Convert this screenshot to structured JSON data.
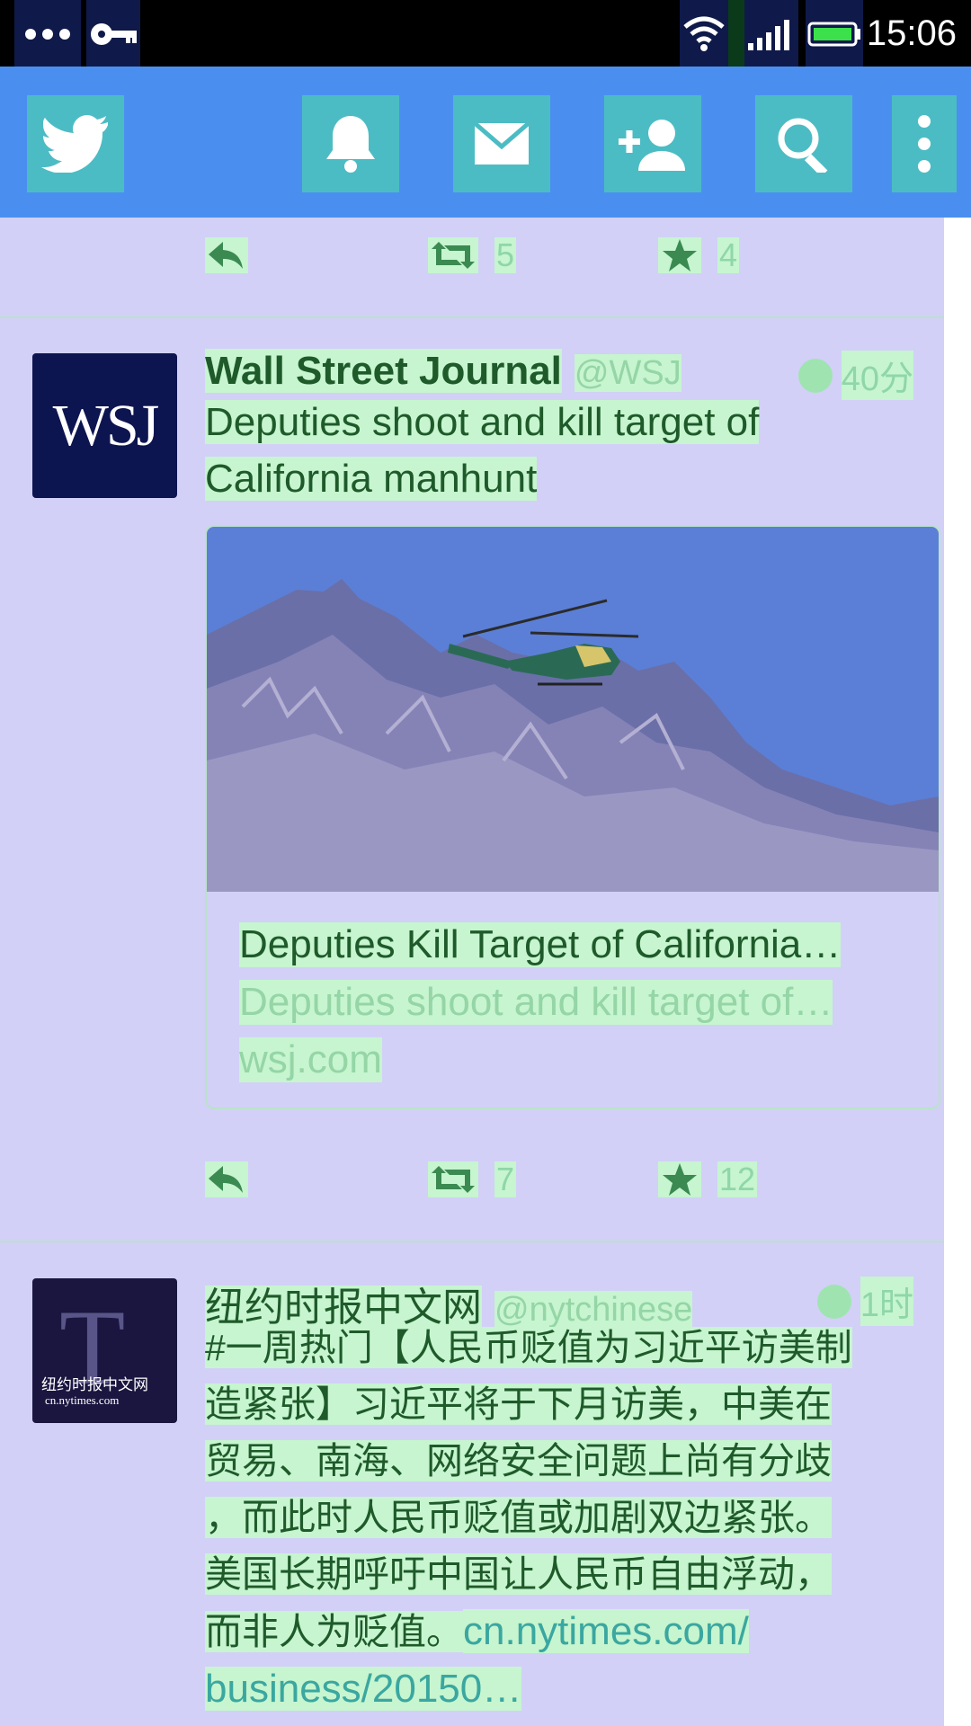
{
  "status_bar": {
    "time": "15:06",
    "icons": [
      "more-dots-icon",
      "key-icon",
      "wifi-icon",
      "signal-icon",
      "battery-icon"
    ]
  },
  "toolbar": {
    "buttons": [
      "twitter-bird-icon",
      "notifications-bell-icon",
      "messages-envelope-icon",
      "add-user-icon",
      "search-icon",
      "more-vert-icon"
    ]
  },
  "tweets": [
    {
      "actions": {
        "retweets": "5",
        "favorites": "4"
      }
    },
    {
      "author": "Wall Street Journal",
      "handle": "@WSJ",
      "time": "40分",
      "avatar_text": "WSJ",
      "text_lines": [
        "Deputies shoot and kill target of",
        "California manhunt"
      ],
      "card": {
        "title": "Deputies Kill Target of California…",
        "description": "Deputies shoot and kill target of…",
        "domain": "wsj.com"
      },
      "actions": {
        "retweets": "7",
        "favorites": "12"
      }
    },
    {
      "author": "纽约时报中文网",
      "handle": "@nytchinese",
      "time": "1时",
      "avatar_text": "纽约时报中文网",
      "avatar_subtext": "cn.nytimes.com",
      "text_lines": [
        "#一周热门【人民币贬值为习近平访美制",
        "造紧张】习近平将于下月访美，中美在",
        "贸易、南海、网络安全问题上尚有分歧",
        "，而此时人民币贬值或加剧双边紧张。",
        "美国长期呼吁中国让人民币自由浮动，"
      ],
      "last_line_text": "而非人为贬值。",
      "link_part1": "cn.nytimes.com/",
      "link_part2": "business/20150…"
    }
  ],
  "colors": {
    "toolbar": "#4a8ff0",
    "icon_box": "#4cbcc4",
    "feed_bg": "#d2d0f7",
    "highlight": "#c6f5cf",
    "text_dark_green": "#1f5a2a",
    "text_light_green": "#95d5a6",
    "link": "#3aa7a0"
  }
}
